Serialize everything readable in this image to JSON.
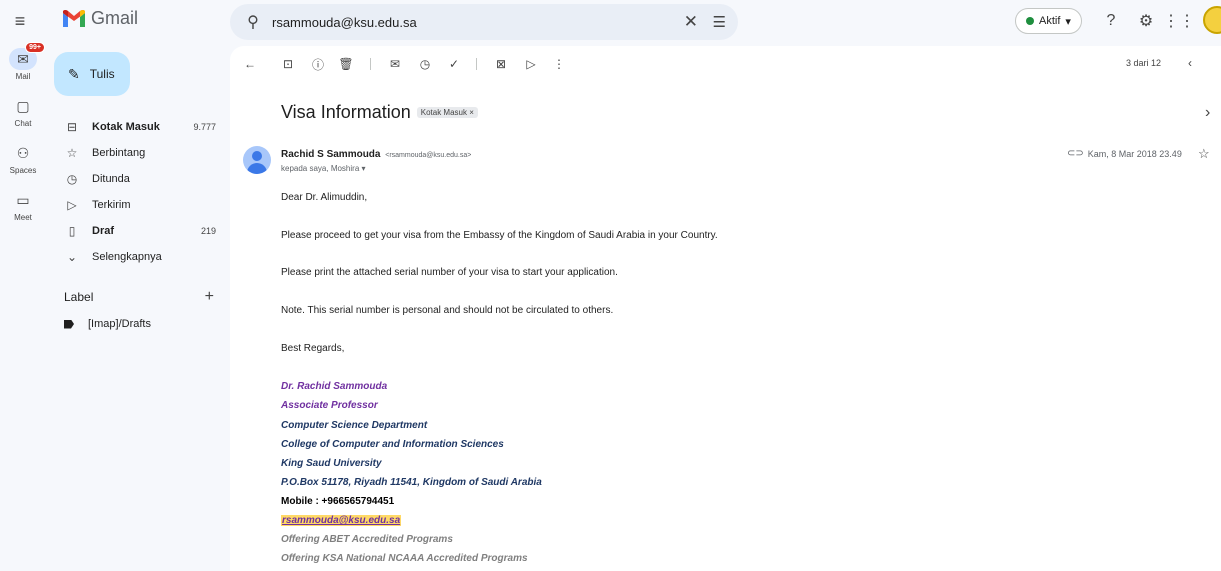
{
  "app": {
    "name": "Gmail"
  },
  "search": {
    "value": "rsammouda@ksu.edu.sa"
  },
  "status": {
    "label": "Aktif"
  },
  "rail": {
    "mail_badge": "99+",
    "items": [
      {
        "label": "Mail",
        "icon": "mail-icon"
      },
      {
        "label": "Chat",
        "icon": "chat-icon"
      },
      {
        "label": "Spaces",
        "icon": "spaces-icon"
      },
      {
        "label": "Meet",
        "icon": "meet-icon"
      }
    ]
  },
  "compose": {
    "label": "Tulis"
  },
  "nav": {
    "items": [
      {
        "label": "Kotak Masuk",
        "count": "9.777",
        "bold": true
      },
      {
        "label": "Berbintang",
        "count": ""
      },
      {
        "label": "Ditunda",
        "count": ""
      },
      {
        "label": "Terkirim",
        "count": ""
      },
      {
        "label": "Draf",
        "count": "219",
        "bold": true
      },
      {
        "label": "Selengkapnya",
        "count": ""
      }
    ]
  },
  "labels": {
    "header": "Label",
    "items": [
      {
        "label": "[Imap]/Drafts"
      }
    ]
  },
  "pager": {
    "text": "3 dari 12"
  },
  "email": {
    "subject": "Visa Information",
    "tag": "Kotak Masuk ×",
    "sender_name": "Rachid S Sammouda",
    "sender_email": "<rsammouda@ksu.edu.sa>",
    "recipients": "kepada saya, Moshira ▾",
    "date": "Kam, 8 Mar 2018 23.49",
    "body": [
      "Dear Dr. Alimuddin,",
      "Please proceed to get your visa from the Embassy of the Kingdom of Saudi Arabia in your Country.",
      "Please print the attached serial number of your visa to start your application.",
      "Note. This serial number is personal and should not be circulated to others.",
      "Best Regards,"
    ],
    "signature": {
      "name": "Dr. Rachid Sammouda",
      "title": "Associate Professor",
      "department": "Computer Science Department",
      "college": "College of Computer and Information Sciences",
      "university": "King Saud University",
      "address": "P.O.Box 51178, Riyadh 11541, Kingdom of Saudi Arabia",
      "mobile": "Mobile : +966565794451",
      "email": "rsammouda@ksu.edu.sa",
      "note1": "Offering ABET Accredited Programs",
      "note2": "Offering KSA National NCAAA Accredited Programs"
    }
  },
  "colors": {
    "accent": "#c2e7ff",
    "active_rail": "#d3e3fd",
    "badge": "#d93025",
    "signature_purple": "#7030a0",
    "signature_navy": "#1f3864"
  }
}
